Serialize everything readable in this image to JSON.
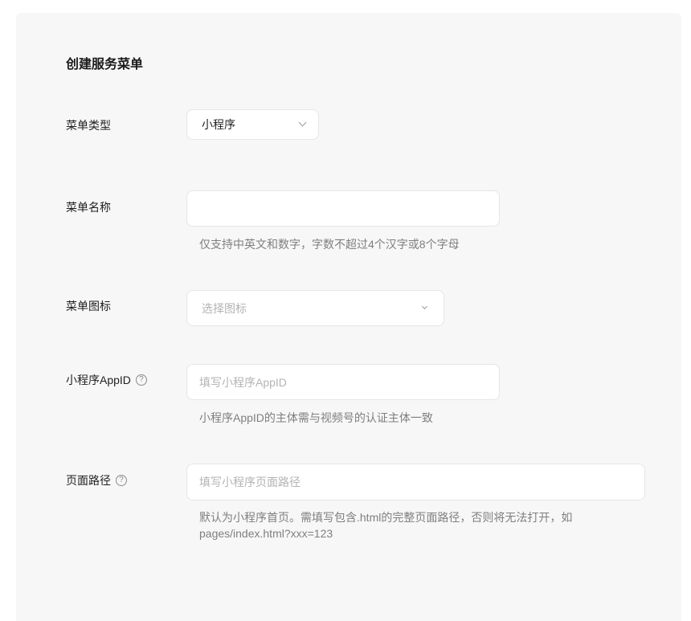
{
  "form": {
    "title": "创建服务菜单",
    "menu_type": {
      "label": "菜单类型",
      "value": "小程序"
    },
    "menu_name": {
      "label": "菜单名称",
      "value": "",
      "placeholder": "",
      "hint": "仅支持中英文和数字，字数不超过4个汉字或8个字母"
    },
    "menu_icon": {
      "label": "菜单图标",
      "placeholder": "选择图标"
    },
    "appid": {
      "label": "小程序AppID",
      "placeholder": "填写小程序AppID",
      "hint": "小程序AppID的主体需与视频号的认证主体一致"
    },
    "page_path": {
      "label": "页面路径",
      "placeholder": "填写小程序页面路径",
      "hint_line1": "默认为小程序首页。需填写包含.html的完整页面路径，否则将无法打开，如",
      "hint_line2": "pages/index.html?xxx=123"
    }
  },
  "icons": {
    "help": "help-circle-icon",
    "dropdown": "chevron-down-icon"
  },
  "colors": {
    "panel_bg": "#f7f7f7",
    "border": "#e6e6e6",
    "placeholder": "#b3b3b3",
    "hint": "#7f7f7f"
  }
}
